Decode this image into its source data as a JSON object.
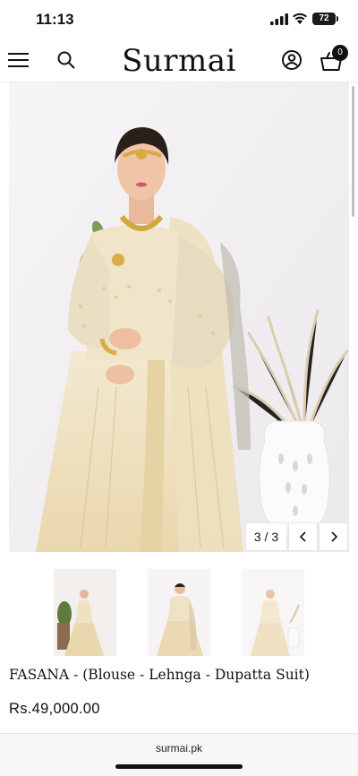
{
  "status_bar": {
    "time": "11:13",
    "battery": "72"
  },
  "header": {
    "logo": "Surmai",
    "cart_count": "0"
  },
  "gallery": {
    "counter": "3 / 3"
  },
  "product": {
    "title": "FASANA - (Blouse - Lehnga - Dupatta Suit)",
    "price": "Rs.49,000.00"
  },
  "browser": {
    "url": "surmai.pk"
  },
  "icons": [
    "menu-icon",
    "search-icon",
    "account-icon",
    "cart-icon",
    "chevron-left-icon",
    "chevron-right-icon"
  ],
  "colors": {
    "accent": "#111111",
    "dress": "#efe3c6",
    "background": "#f3f1f3"
  }
}
